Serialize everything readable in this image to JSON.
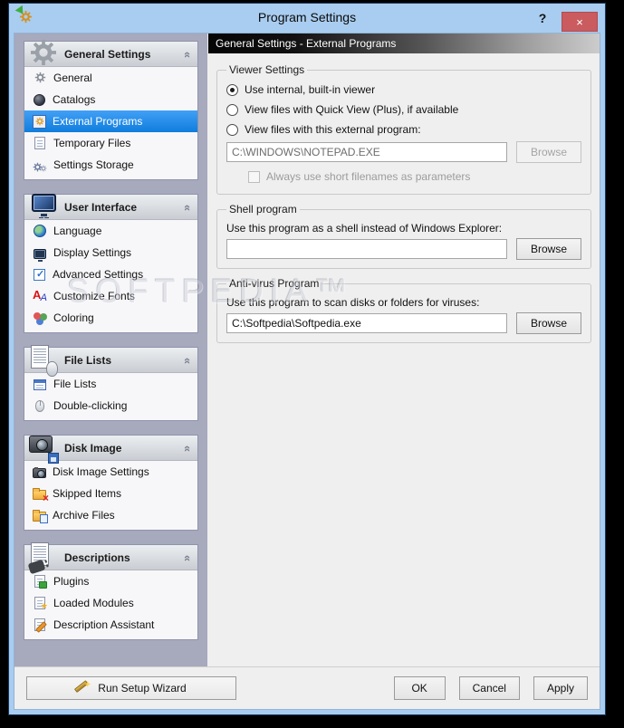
{
  "window": {
    "title": "Program Settings",
    "help_label": "?",
    "close_label": "×"
  },
  "watermark": "SOFTPEDIA™",
  "sidebar": {
    "groups": [
      {
        "title": "General Settings",
        "icon": "gear-large",
        "items": [
          {
            "label": "General",
            "icon": "gear-small",
            "selected": false
          },
          {
            "label": "Catalogs",
            "icon": "disc",
            "selected": false
          },
          {
            "label": "External Programs",
            "icon": "external-program-gear",
            "selected": true
          },
          {
            "label": "Temporary Files",
            "icon": "document",
            "selected": false
          },
          {
            "label": "Settings Storage",
            "icon": "gears-storage",
            "selected": false
          }
        ]
      },
      {
        "title": "User Interface",
        "icon": "monitor-large",
        "items": [
          {
            "label": "Language",
            "icon": "globe",
            "selected": false
          },
          {
            "label": "Display Settings",
            "icon": "monitor",
            "selected": false
          },
          {
            "label": "Advanced Settings",
            "icon": "checkbox-check",
            "selected": false
          },
          {
            "label": "Customize Fonts",
            "icon": "letters-aa",
            "selected": false
          },
          {
            "label": "Coloring",
            "icon": "color-circles",
            "selected": false
          }
        ]
      },
      {
        "title": "File Lists",
        "icon": "list-mouse-large",
        "items": [
          {
            "label": "File Lists",
            "icon": "table",
            "selected": false
          },
          {
            "label": "Double-clicking",
            "icon": "mouse",
            "selected": false
          }
        ]
      },
      {
        "title": "Disk Image",
        "icon": "camera-floppy-large",
        "items": [
          {
            "label": "Disk Image Settings",
            "icon": "camera",
            "selected": false
          },
          {
            "label": "Skipped Items",
            "icon": "folder-x",
            "selected": false
          },
          {
            "label": "Archive Files",
            "icon": "folder-archive",
            "selected": false
          }
        ]
      },
      {
        "title": "Descriptions",
        "icon": "page-plug-large",
        "items": [
          {
            "label": "Plugins",
            "icon": "page-plug",
            "selected": false
          },
          {
            "label": "Loaded Modules",
            "icon": "page-star",
            "selected": false
          },
          {
            "label": "Description Assistant",
            "icon": "page-pencil",
            "selected": false
          }
        ]
      }
    ]
  },
  "main": {
    "header": "General Settings - External Programs",
    "viewer": {
      "legend": "Viewer Settings",
      "radio_internal": "Use internal, built-in viewer",
      "radio_quickview": "View files with Quick View (Plus), if available",
      "radio_external": "View files with this external program:",
      "external_path": "C:\\WINDOWS\\NOTEPAD.EXE",
      "browse_label": "Browse",
      "checkbox_label": "Always use short filenames as parameters"
    },
    "shell": {
      "legend": "Shell program",
      "label": "Use this program as a shell instead of Windows Explorer:",
      "value": "",
      "browse_label": "Browse"
    },
    "antivirus": {
      "legend": "Anti-virus Program",
      "label": "Use this program to scan disks or folders for viruses:",
      "value": "C:\\Softpedia\\Softpedia.exe",
      "browse_label": "Browse"
    }
  },
  "footer": {
    "wizard_label": "Run Setup Wizard",
    "ok_label": "OK",
    "cancel_label": "Cancel",
    "apply_label": "Apply"
  },
  "colors": {
    "titlebar": "#a9cdf0",
    "close_button": "#ca5b5e",
    "selection": "#1f8ceb",
    "sidebar_backdrop": "#a7a9bd",
    "content_bg": "#efefef",
    "header_gradient_start": "#050505",
    "header_gradient_end": "#cccccc"
  }
}
